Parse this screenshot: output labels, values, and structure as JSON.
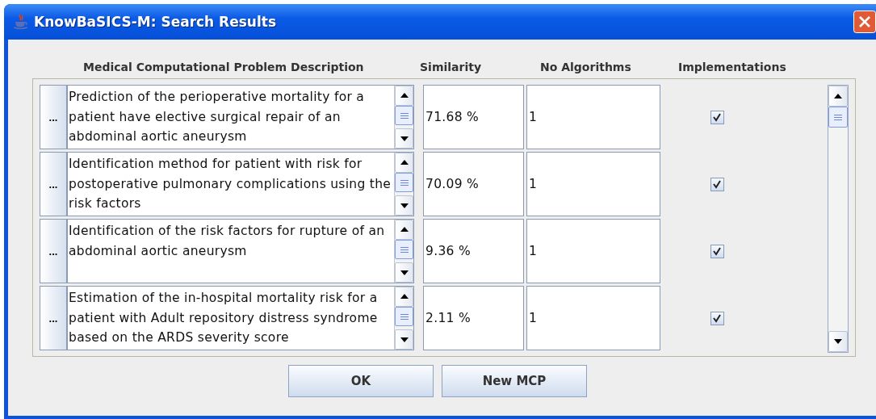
{
  "window": {
    "title": "KnowBaSICS-M: Search Results"
  },
  "table": {
    "columns": [
      "Medical Computational Problem Description",
      "Similarity",
      "No Algorithms",
      "Implementations"
    ],
    "rows": [
      {
        "button": "...",
        "description": "Prediction of the perioperative mortality for a patient have elective surgical repair of an abdominal aortic aneurysm",
        "similarity": "71.68 %",
        "algorithms": "1",
        "implemented": true
      },
      {
        "button": "...",
        "description": "Identification method for patient with risk for postoperative pulmonary complications using the risk factors",
        "similarity": "70.09 %",
        "algorithms": "1",
        "implemented": true
      },
      {
        "button": "...",
        "description": "Identification of the risk factors for rupture of an abdominal aortic aneurysm",
        "similarity": "9.36 %",
        "algorithms": "1",
        "implemented": true
      },
      {
        "button": "...",
        "description": "Estimation of the in-hospital mortality risk for a patient with Adult repository distress syndrome based on the ARDS severity score",
        "similarity": "2.11 %",
        "algorithms": "1",
        "implemented": true
      }
    ]
  },
  "buttons": [
    "OK",
    "New MCP"
  ]
}
